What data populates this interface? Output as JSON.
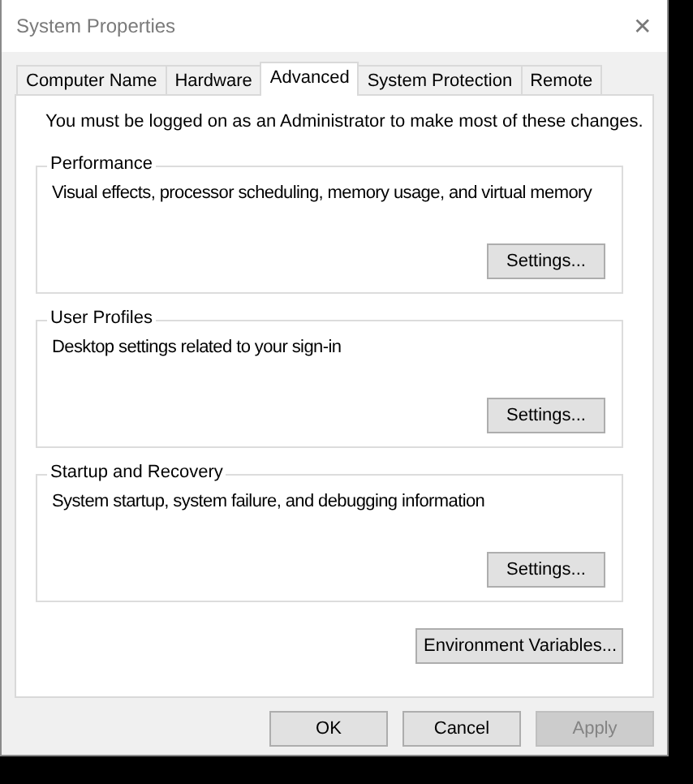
{
  "window": {
    "title": "System Properties",
    "close": "✕"
  },
  "tabs": [
    {
      "label": "Computer Name",
      "selected": false
    },
    {
      "label": "Hardware",
      "selected": false
    },
    {
      "label": "Advanced",
      "selected": true
    },
    {
      "label": "System Protection",
      "selected": false
    },
    {
      "label": "Remote",
      "selected": false
    }
  ],
  "notice": "You must be logged on as an Administrator to make most of these changes.",
  "groups": [
    {
      "title": "Performance",
      "description": "Visual effects, processor scheduling, memory usage, and virtual memory",
      "button": "Settings..."
    },
    {
      "title": "User Profiles",
      "description": "Desktop settings related to your sign-in",
      "button": "Settings..."
    },
    {
      "title": "Startup and Recovery",
      "description": "System startup, system failure, and debugging information",
      "button": "Settings..."
    }
  ],
  "environment_button": "Environment Variables...",
  "buttons": [
    {
      "label": "OK",
      "disabled": false
    },
    {
      "label": "Cancel",
      "disabled": false
    },
    {
      "label": "Apply",
      "disabled": true
    }
  ]
}
